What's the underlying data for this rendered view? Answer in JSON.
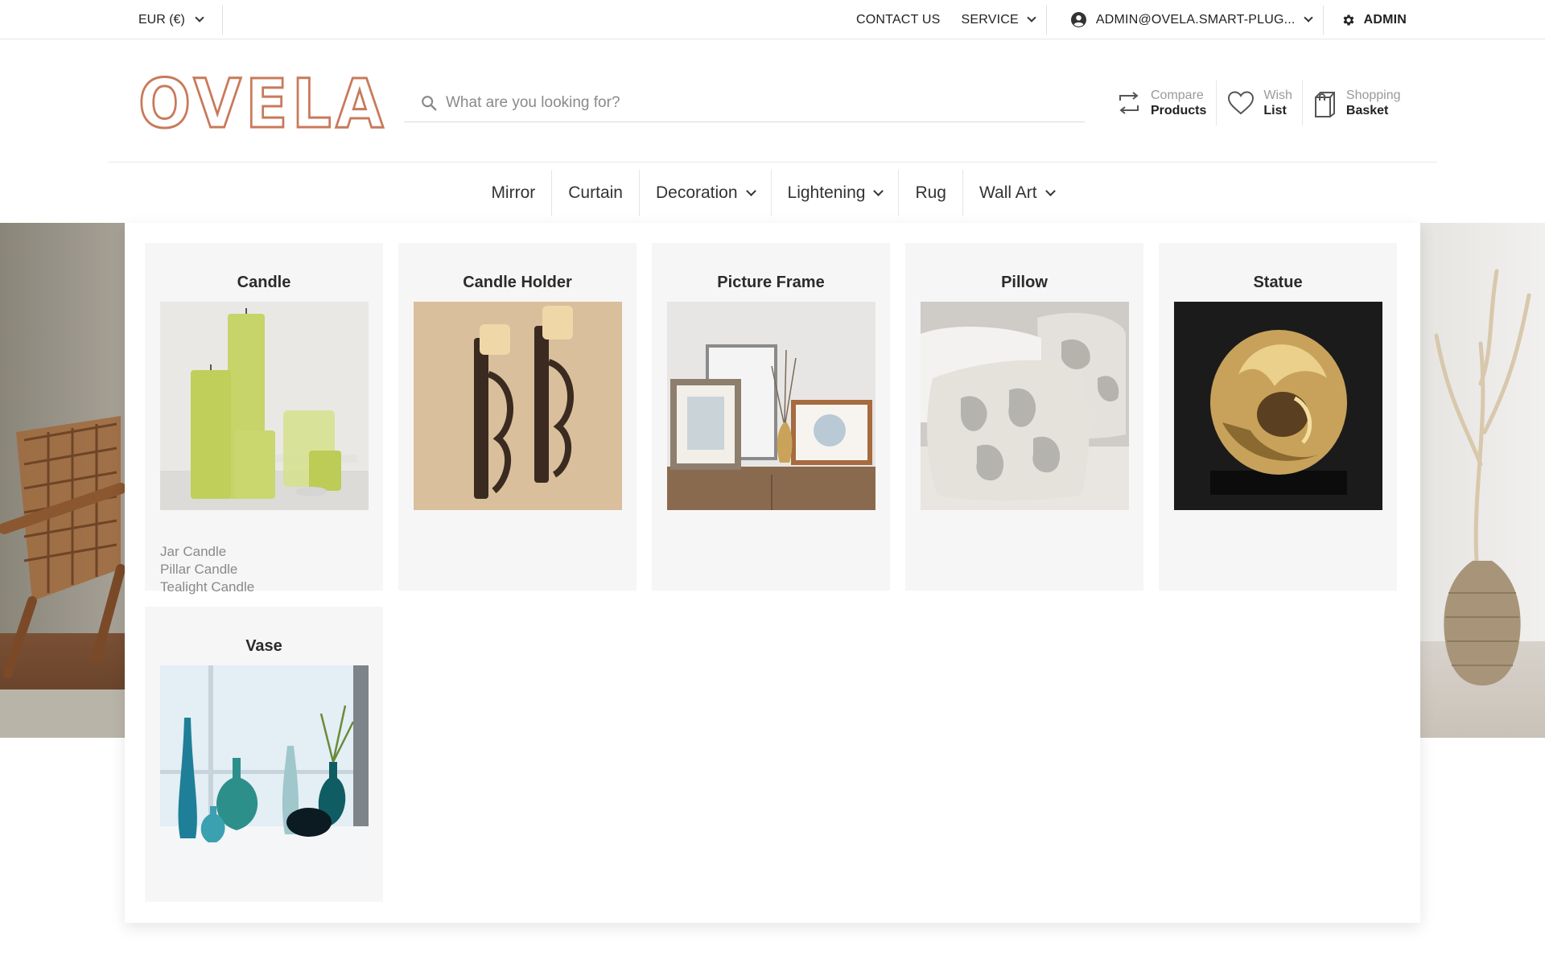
{
  "topbar": {
    "currency": "EUR (€)",
    "contact": "CONTACT US",
    "service": "SERVICE",
    "account": "ADMIN@OVELA.SMART-PLUG...",
    "admin": "ADMIN"
  },
  "header": {
    "logo_text": "OVELA",
    "search_placeholder": "What are you looking for?",
    "actions": [
      {
        "line1": "Compare",
        "line2": "Products"
      },
      {
        "line1": "Wish",
        "line2": "List"
      },
      {
        "line1": "Shopping",
        "line2": "Basket"
      }
    ]
  },
  "nav": {
    "items": [
      {
        "label": "Mirror"
      },
      {
        "label": "Curtain"
      },
      {
        "label": "Decoration"
      },
      {
        "label": "Lightening"
      },
      {
        "label": "Rug"
      },
      {
        "label": "Wall Art"
      }
    ]
  },
  "mega": {
    "categories": [
      {
        "title": "Candle",
        "subs": [
          "Jar Candle",
          "Pillar Candle",
          "Tealight Candle"
        ]
      },
      {
        "title": "Candle Holder",
        "subs": []
      },
      {
        "title": "Picture Frame",
        "subs": []
      },
      {
        "title": "Pillow",
        "subs": []
      },
      {
        "title": "Statue",
        "subs": []
      },
      {
        "title": "Vase",
        "subs": []
      }
    ]
  },
  "colors": {
    "brand": "#c87a5a",
    "card_bg": "#f6f6f7",
    "muted_text": "#8a8a8a"
  }
}
